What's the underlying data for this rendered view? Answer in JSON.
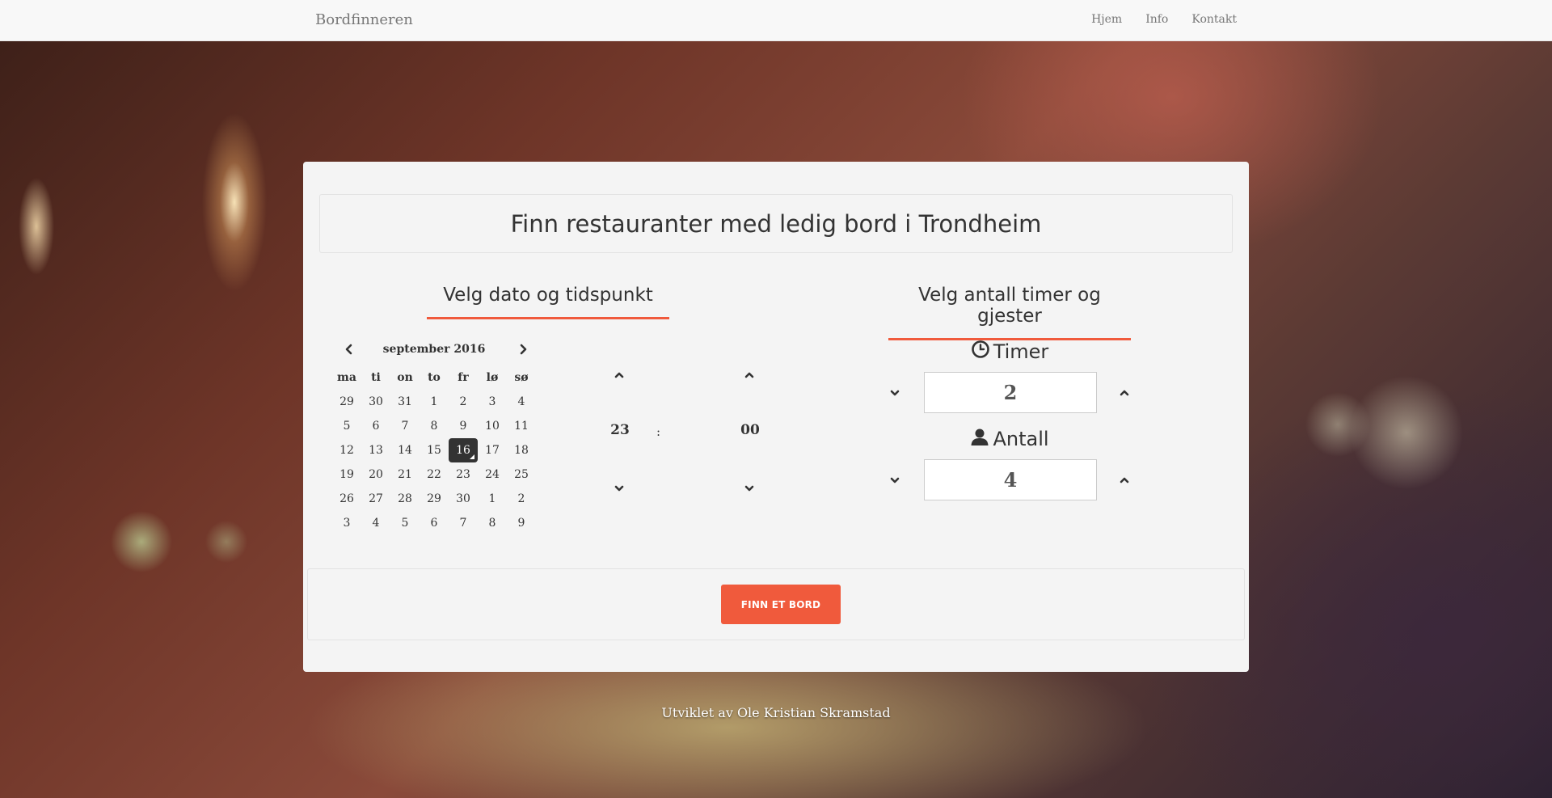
{
  "navbar": {
    "brand": "Bordfinneren",
    "links": [
      "Hjem",
      "Info",
      "Kontakt"
    ]
  },
  "main": {
    "title": "Finn restauranter med ledig bord i Trondheim",
    "left_heading": "Velg dato og tidspunkt",
    "right_heading": "Velg antall timer og gjester"
  },
  "calendar": {
    "month_label": "september 2016",
    "weekdays": [
      "ma",
      "ti",
      "on",
      "to",
      "fr",
      "lø",
      "sø"
    ],
    "days": [
      [
        "29",
        "30",
        "31",
        "1",
        "2",
        "3",
        "4"
      ],
      [
        "5",
        "6",
        "7",
        "8",
        "9",
        "10",
        "11"
      ],
      [
        "12",
        "13",
        "14",
        "15",
        "16",
        "17",
        "18"
      ],
      [
        "19",
        "20",
        "21",
        "22",
        "23",
        "24",
        "25"
      ],
      [
        "26",
        "27",
        "28",
        "29",
        "30",
        "1",
        "2"
      ],
      [
        "3",
        "4",
        "5",
        "6",
        "7",
        "8",
        "9"
      ]
    ],
    "selected_day": "16"
  },
  "time": {
    "hour": "23",
    "separator": ":",
    "minute": "00"
  },
  "counters": {
    "timer_label": "Timer",
    "timer_value": "2",
    "antall_label": "Antall",
    "antall_value": "4"
  },
  "actions": {
    "find_button": "FINN ET BORD"
  },
  "footer": {
    "credit": "Utviklet av Ole Kristian Skramstad"
  },
  "colors": {
    "accent": "#f05a3c",
    "panel": "#f4f4f4",
    "selected_day": "#333333"
  },
  "icons": [
    "chevron-left-icon",
    "chevron-right-icon",
    "chevron-up-icon",
    "chevron-down-icon",
    "clock-icon",
    "user-icon"
  ]
}
